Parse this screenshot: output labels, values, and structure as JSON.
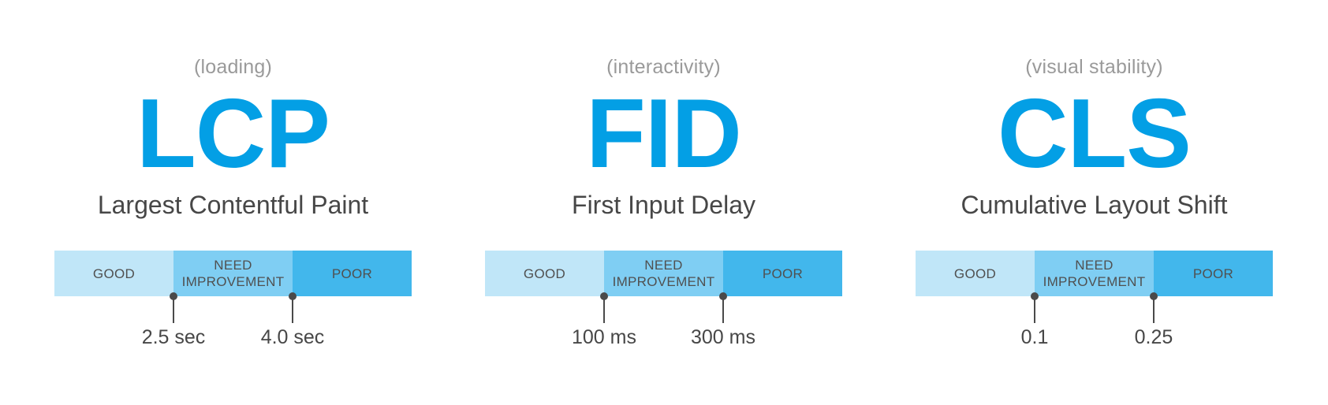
{
  "colors": {
    "acronym": "#039fe5",
    "category": "#9a9a9a",
    "text": "#474747",
    "good": "#c0e6f8",
    "need_improvement": "#7fcef3",
    "poor": "#42b7ec",
    "marker": "#4a4a4a"
  },
  "metrics": [
    {
      "category": "(loading)",
      "acronym": "LCP",
      "name": "Largest Contentful Paint",
      "segments": [
        "GOOD",
        "NEED\nIMPROVEMENT",
        "POOR"
      ],
      "thresholds": [
        "2.5 sec",
        "4.0 sec"
      ]
    },
    {
      "category": "(interactivity)",
      "acronym": "FID",
      "name": "First Input Delay",
      "segments": [
        "GOOD",
        "NEED\nIMPROVEMENT",
        "POOR"
      ],
      "thresholds": [
        "100 ms",
        "300 ms"
      ]
    },
    {
      "category": "(visual stability)",
      "acronym": "CLS",
      "name": "Cumulative Layout Shift",
      "segments": [
        "GOOD",
        "NEED\nIMPROVEMENT",
        "POOR"
      ],
      "thresholds": [
        "0.1",
        "0.25"
      ]
    }
  ]
}
